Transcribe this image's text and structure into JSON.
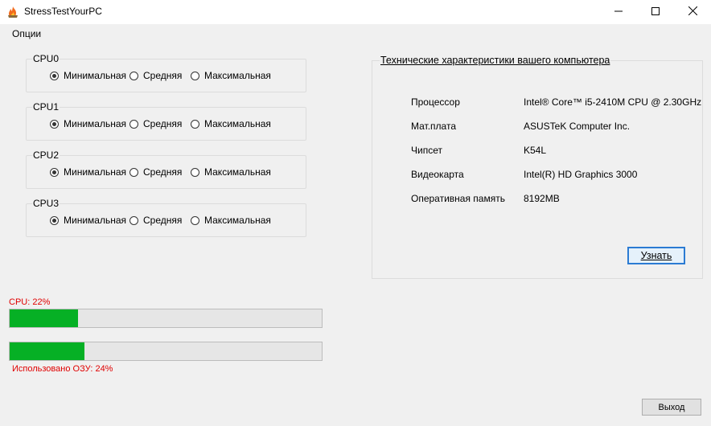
{
  "window": {
    "title": "StressTestYourPC",
    "icon": "flame-icon",
    "controls": [
      "minimize-icon",
      "maximize-icon",
      "close-icon"
    ]
  },
  "menu": {
    "options": "Опции"
  },
  "load_levels": [
    "Минимальная",
    "Средняя",
    "Максимальная"
  ],
  "cpu_groups": [
    {
      "label": "CPU0",
      "selected": "Минимальная"
    },
    {
      "label": "CPU1",
      "selected": "Минимальная"
    },
    {
      "label": "CPU2",
      "selected": "Минимальная"
    },
    {
      "label": "CPU3",
      "selected": "Минимальная"
    }
  ],
  "specs": {
    "title": "Технические характеристики вашего компьютера",
    "rows": [
      {
        "label": "Процессор",
        "value": "Intel® Core™ i5-2410M CPU @ 2.30GHz"
      },
      {
        "label": "Мат.плата",
        "value": "ASUSTeK Computer Inc."
      },
      {
        "label": "Чипсет",
        "value": "K54L"
      },
      {
        "label": "Видеокарта",
        "value": "Intel(R) HD Graphics 3000"
      },
      {
        "label": "Оперативная память",
        "value": "8192MB"
      }
    ],
    "learn_button": "Узнать"
  },
  "usage": {
    "cpu_label": "CPU: 22%",
    "cpu_percent": 22,
    "ram_label": "Использовано ОЗУ: 24%",
    "ram_percent": 24
  },
  "colors": {
    "progress": "#06b025",
    "usage_text": "#e00000",
    "focus_border": "#2b7bd3"
  },
  "exit_button": "Выход"
}
